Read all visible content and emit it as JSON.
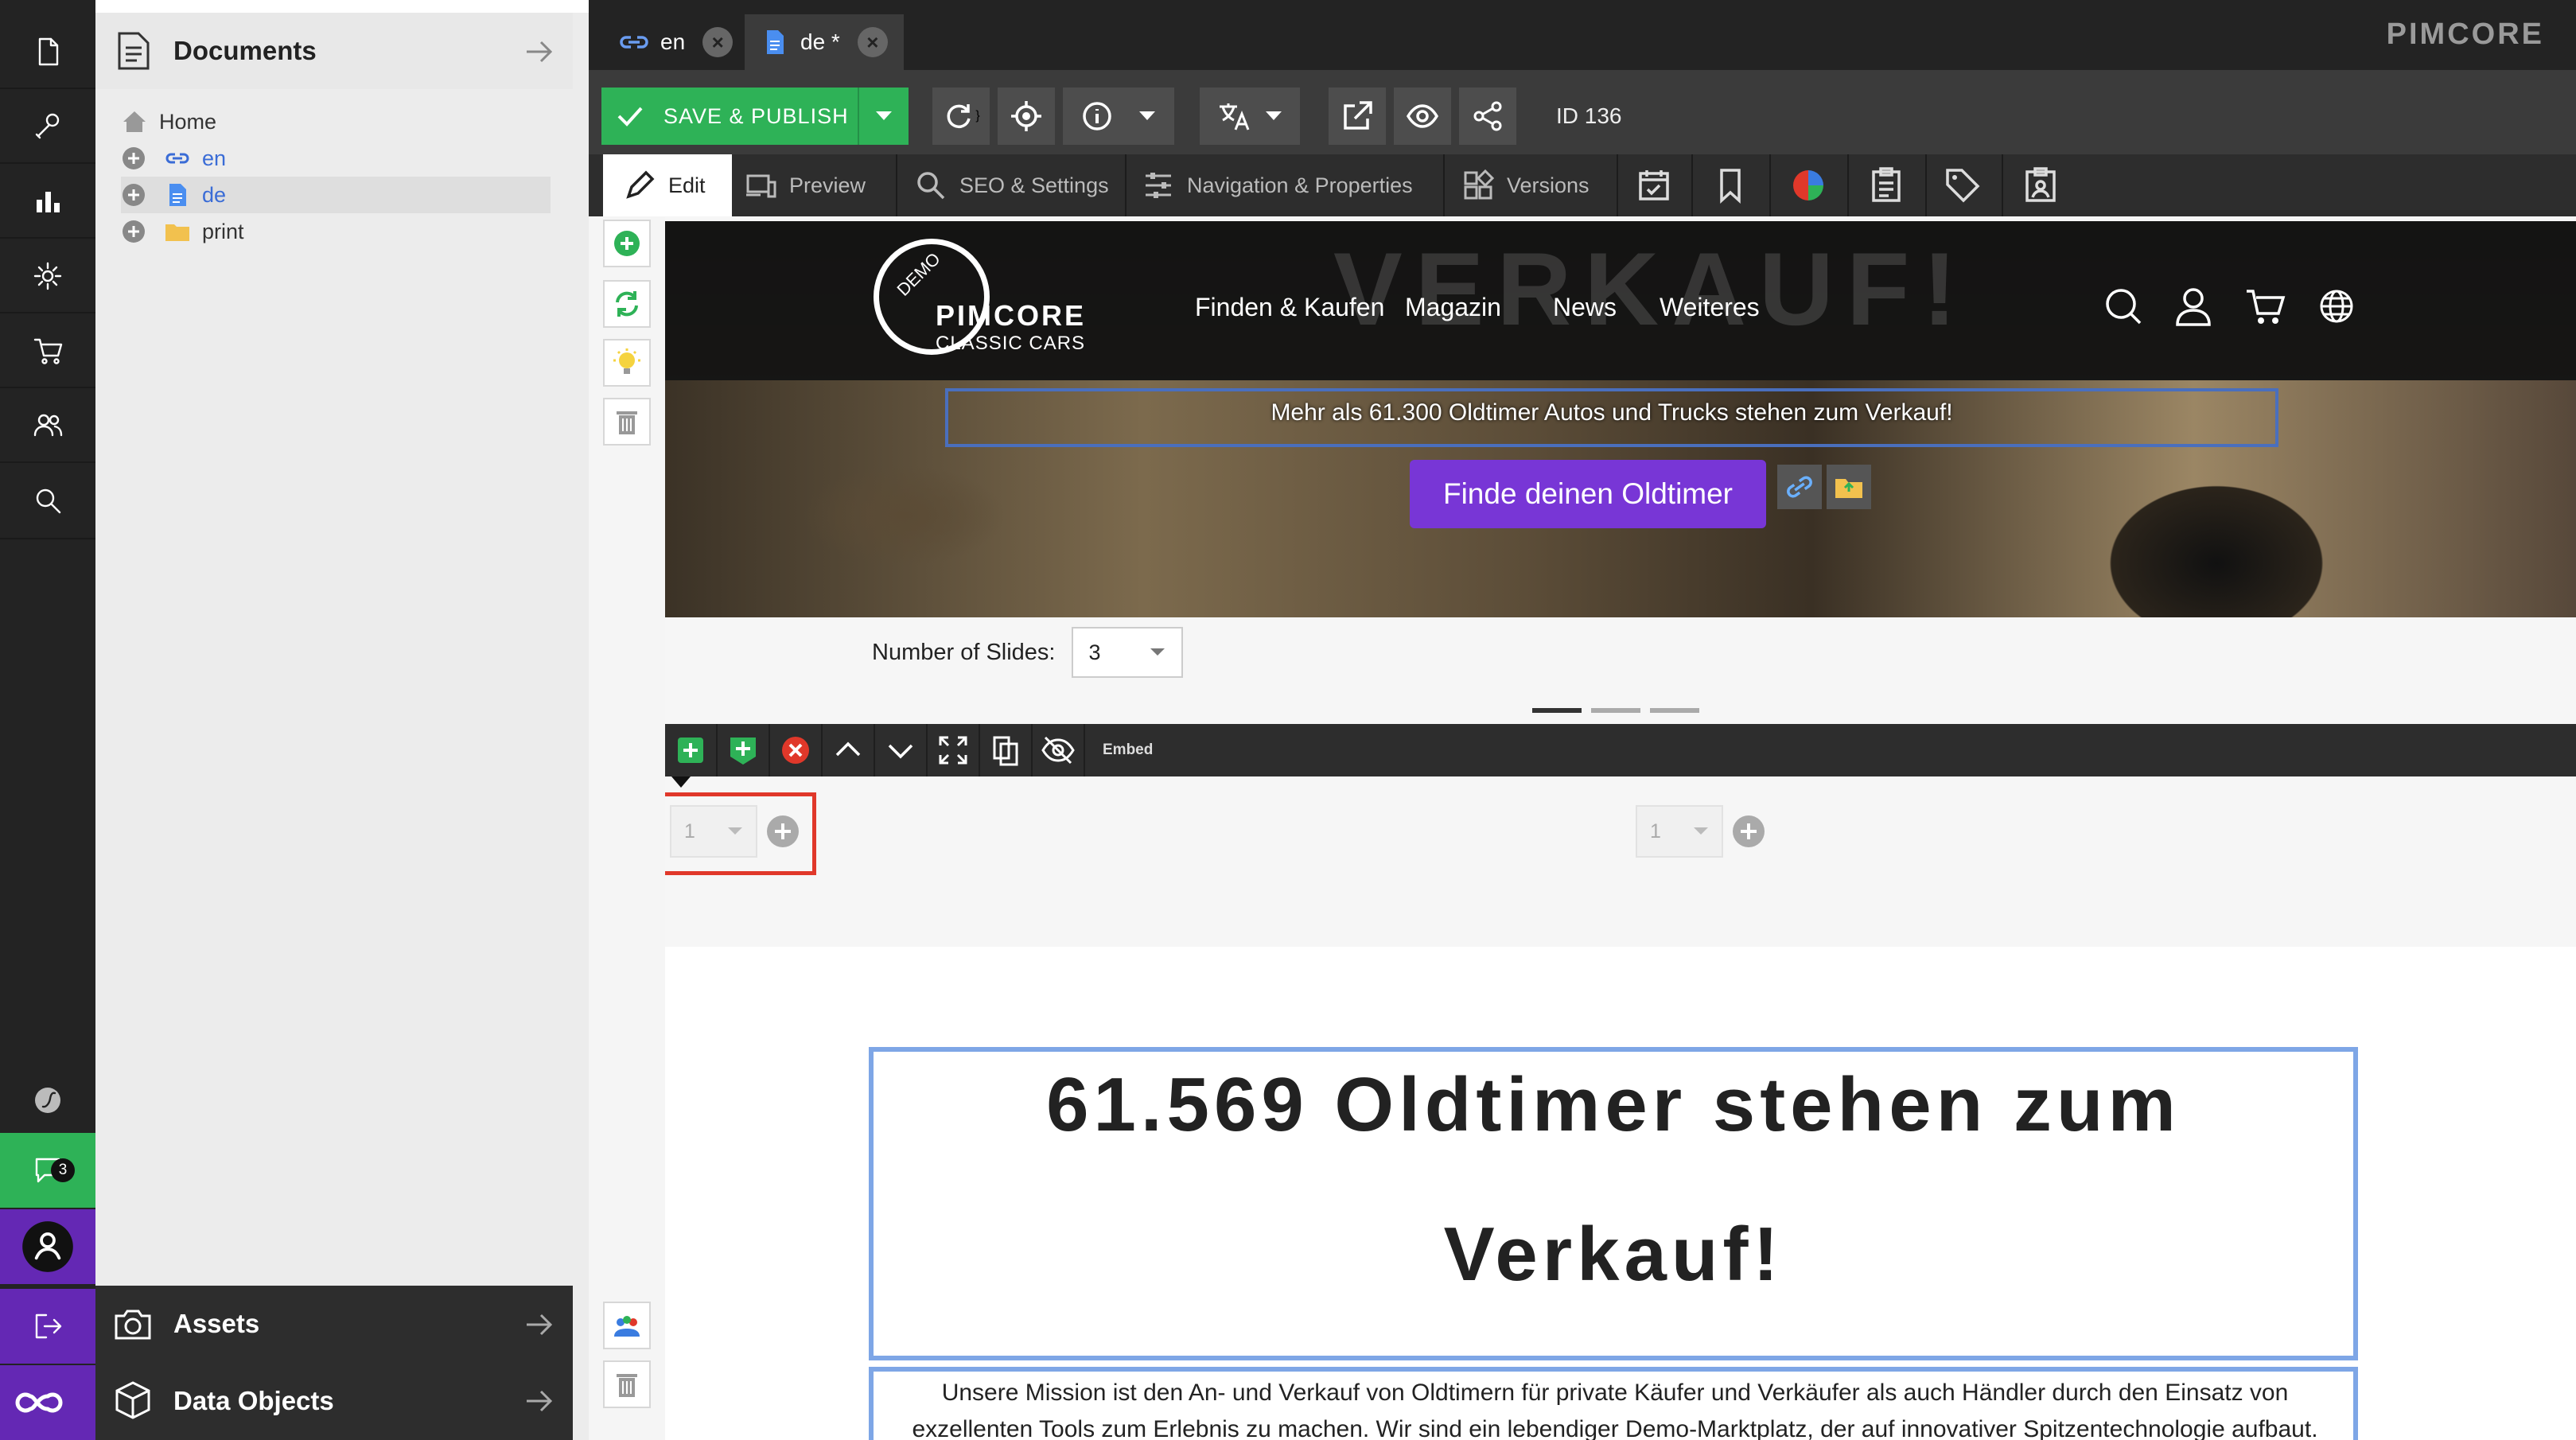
{
  "tree": {
    "title": "Documents",
    "items": [
      {
        "label": "Home",
        "icon": "home-icon"
      },
      {
        "label": "en",
        "icon": "link-icon"
      },
      {
        "label": "de",
        "icon": "page-icon"
      },
      {
        "label": "print",
        "icon": "folder-icon"
      }
    ],
    "assets": "Assets",
    "objects": "Data Objects"
  },
  "nav": {
    "notification_count": "3"
  },
  "tabs": [
    {
      "label": "en"
    },
    {
      "label": "de *"
    }
  ],
  "brand": "PIMCORE",
  "toolbar": {
    "save_label": "SAVE & PUBLISH",
    "id_label": "ID 136"
  },
  "edit_tabs": [
    {
      "label": "Edit"
    },
    {
      "label": "Preview"
    },
    {
      "label": "SEO & Settings"
    },
    {
      "label": "Navigation & Properties"
    },
    {
      "label": "Versions"
    }
  ],
  "hero": {
    "bg_word": "VERKAUF!",
    "logo_badge": "DEMO",
    "logo_title": "PIMCORE",
    "logo_sub": "CLASSIC CARS",
    "menu": [
      "Finden & Kaufen",
      "Magazin",
      "News",
      "Weiteres"
    ],
    "subtitle": "Mehr als 61.300 Oldtimer Autos und Trucks stehen zum Verkauf!",
    "button": "Finde deinen Oldtimer"
  },
  "slides": {
    "label": "Number of Slides:",
    "value": "3",
    "active_dot": 1,
    "dot_count": 3
  },
  "areablock": {
    "label": "Embed",
    "left_select": "1",
    "right_select": "1"
  },
  "content": {
    "title_line1": "61.569 Oldtimer stehen zum",
    "title_line2": "Verkauf!",
    "text": "Unsere Mission ist den An- und Verkauf von Oldtimern für private Käufer und Verkäufer als auch Händler durch den Einsatz von exzellenten Tools zum Erlebnis zu machen. Wir sind ein lebendiger Demo-Marktplatz, der auf innovativer Spitzentechnologie aufbaut."
  },
  "colors": {
    "accent_green": "#2eb257",
    "accent_purple": "#6428b4",
    "button_purple": "#7836d6",
    "highlight_red": "#e0382a",
    "edit_outline": "#7ea6e6"
  }
}
